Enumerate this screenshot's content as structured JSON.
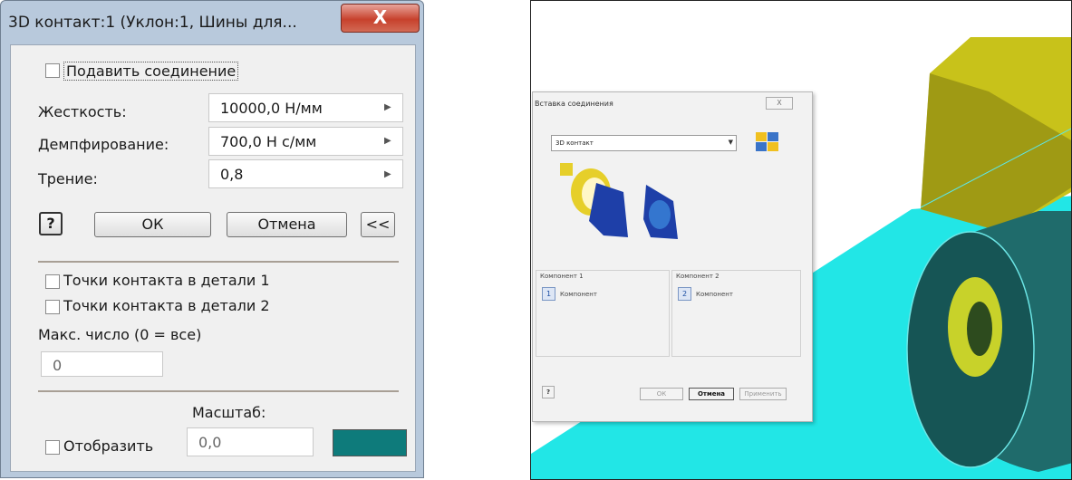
{
  "dialog": {
    "title": "3D контакт:1 (Уклон:1, Шины для...",
    "close_glyph": "X",
    "suppress_label": "Подавить соединение",
    "stiffness_label": "Жесткость:",
    "stiffness_value": "10000,0 Н/мм",
    "damping_label": "Демпфирование:",
    "damping_value": "700,0 Н с/мм",
    "friction_label": "Трение:",
    "friction_value": "0,8",
    "help_glyph": "?",
    "ok_label": "ОК",
    "cancel_label": "Отмена",
    "collapse_label": "<<",
    "contact_points_1_label": "Точки контакта в детали 1",
    "contact_points_2_label": "Точки контакта в детали 2",
    "max_number_label": "Макс. число (0 = все)",
    "max_number_value": "0",
    "scale_label": "Масштаб:",
    "display_label": "Отобразить",
    "scale_value": "0,0",
    "display_color": "#0e7b7b"
  },
  "screenshot": {
    "dialog_title": "Вставка соединения",
    "close_glyph": "X",
    "joint_type": "3D контакт",
    "component1_group": "Компонент 1",
    "component1_label": "Компонент",
    "component1_index": "1",
    "component2_group": "Компонент 2",
    "component2_label": "Компонент",
    "component2_index": "2",
    "ok_label": "ОК",
    "cancel_label": "Отмена",
    "apply_label": "Применить",
    "help_glyph": "?",
    "colors": {
      "floor": "#22e6e6",
      "box": "#c8c21a",
      "wheel": "#1f6b6b",
      "hub": "#c8d22a"
    }
  }
}
